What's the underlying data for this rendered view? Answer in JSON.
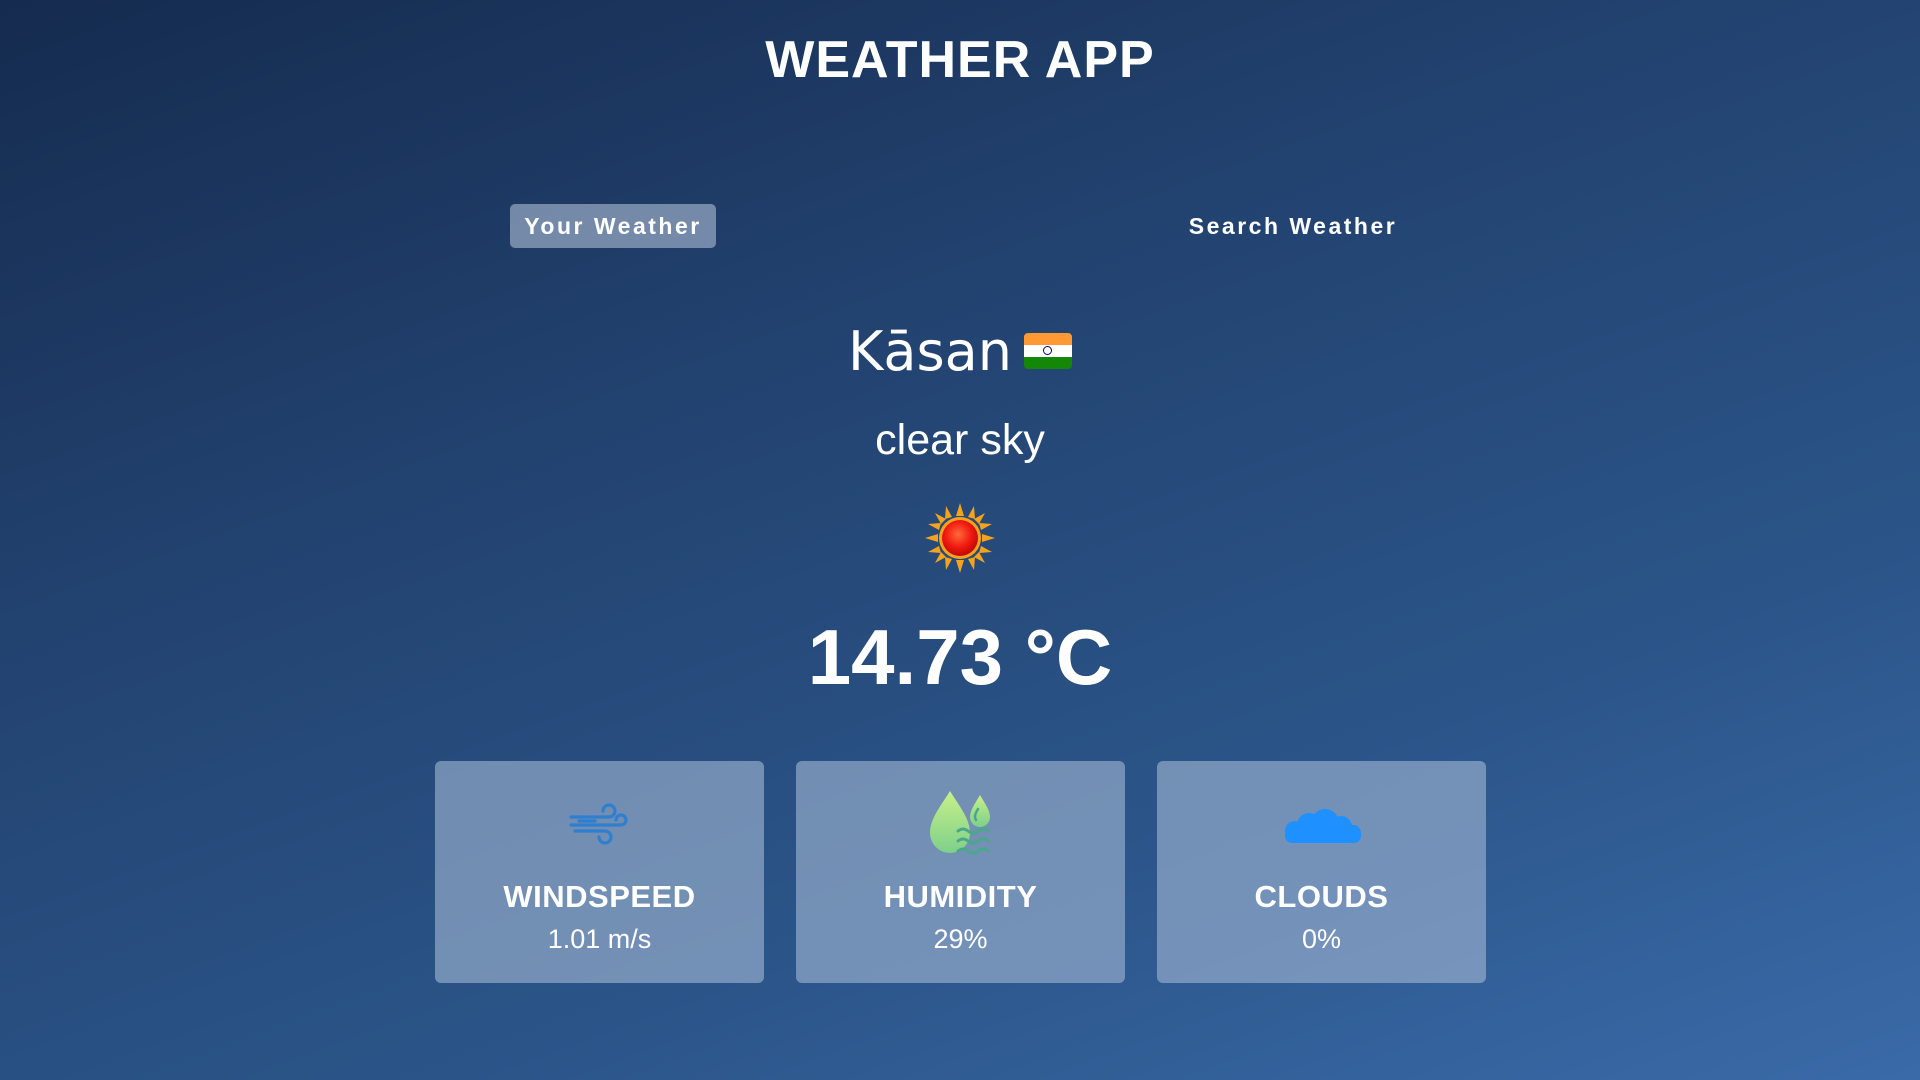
{
  "app": {
    "title": "WEATHER APP"
  },
  "tabs": [
    {
      "label": "Your Weather",
      "active": true
    },
    {
      "label": "Search Weather",
      "active": false
    }
  ],
  "location": {
    "city": "Kāsan",
    "flag": "india-flag-icon"
  },
  "weather": {
    "description": "clear sky",
    "icon": "sun-icon",
    "temperature": "14.73 °C"
  },
  "stats": [
    {
      "label": "WINDSPEED",
      "value": "1.01 m/s",
      "icon": "wind-icon",
      "color": "#2f7fd0"
    },
    {
      "label": "HUMIDITY",
      "value": "29%",
      "icon": "humidity-drops-icon",
      "color": "#a6e07a"
    },
    {
      "label": "CLOUDS",
      "value": "0%",
      "icon": "cloud-icon",
      "color": "#1e90ff"
    }
  ],
  "colors": {
    "background_top": "#152b4f",
    "background_bottom": "#3a6aa8",
    "card_background": "#9fb4d2",
    "active_tab": "#afbed6"
  }
}
